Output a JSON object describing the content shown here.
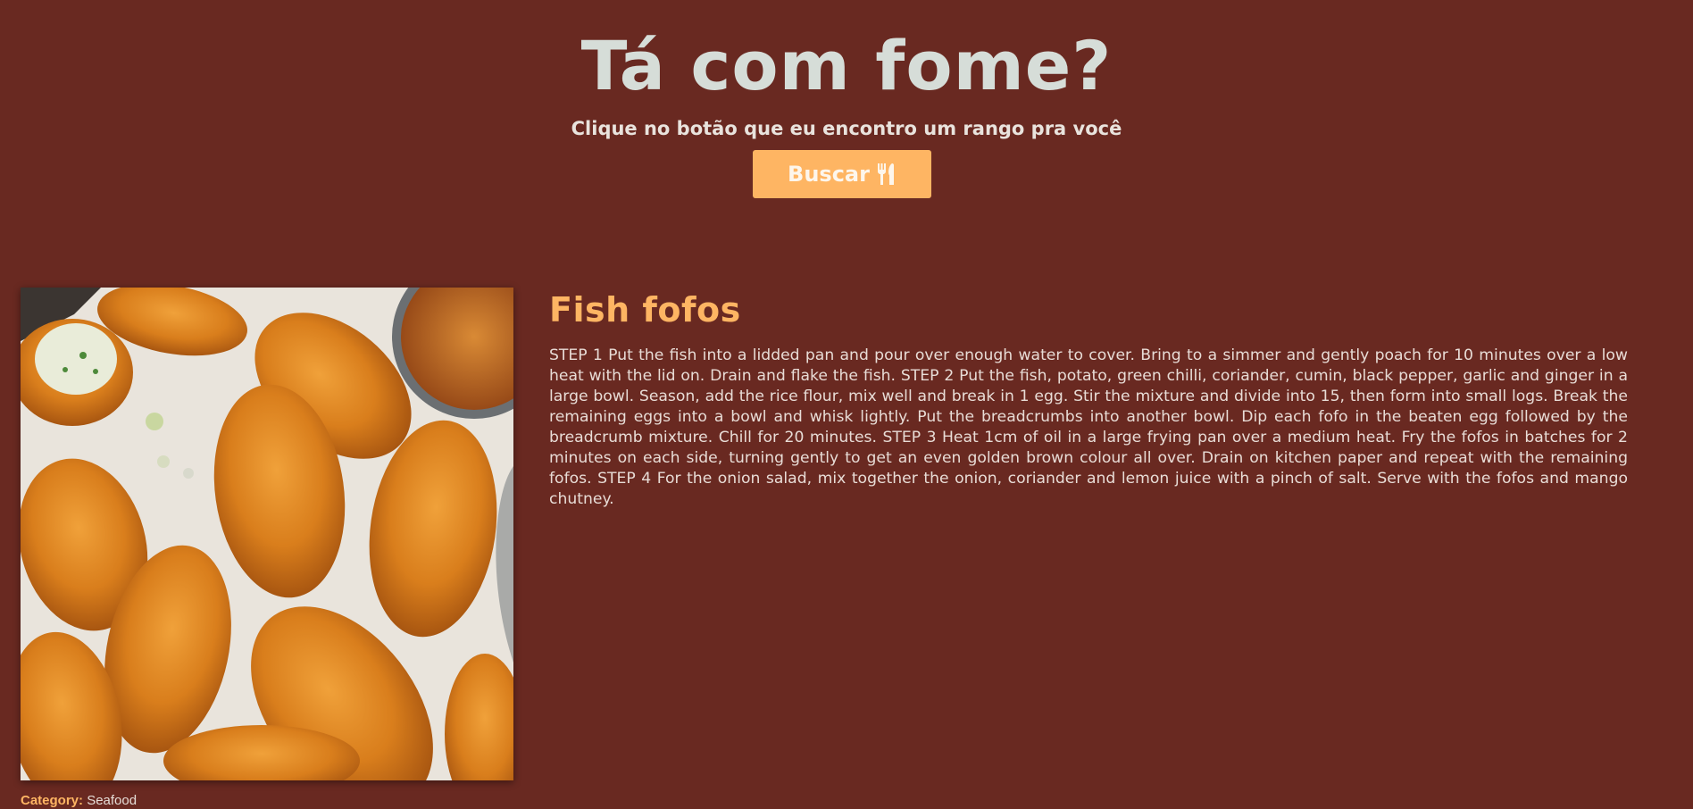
{
  "header": {
    "title": "Tá com fome?",
    "subtitle": "Clique no botão que eu encontro um rango pra você",
    "search_button_label": "Buscar",
    "search_button_icon": "utensils-icon"
  },
  "meal": {
    "name": "Fish fofos",
    "image_alt": "Fish fofos",
    "category_label": "Category:",
    "category": "Seafood",
    "instructions": "STEP 1 Put the fish into a lidded pan and pour over enough water to cover. Bring to a simmer and gently poach for 10 minutes over a low heat with the lid on. Drain and flake the fish. STEP 2 Put the fish, potato, green chilli, coriander, cumin, black pepper, garlic and ginger in a large bowl. Season, add the rice flour, mix well and break in 1 egg. Stir the mixture and divide into 15, then form into small logs. Break the remaining eggs into a bowl and whisk lightly. Put the breadcrumbs into another bowl. Dip each fofo in the beaten egg followed by the breadcrumb mixture. Chill for 20 minutes. STEP 3 Heat 1cm of oil in a large frying pan over a medium heat. Fry the fofos in batches for 2 minutes on each side, turning gently to get an even golden brown colour all over. Drain on kitchen paper and repeat with the remaining fofos. STEP 4 For the onion salad, mix together the onion, coriander and lemon juice with a pinch of salt. Serve with the fofos and mango chutney."
  },
  "colors": {
    "background": "#692921",
    "accent": "#feb563",
    "title": "#d6ddd8",
    "text": "#e8dcd6"
  }
}
